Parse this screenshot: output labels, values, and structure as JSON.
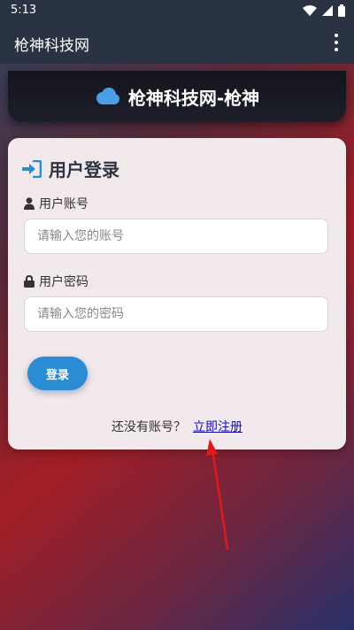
{
  "status_bar": {
    "time": "5:13"
  },
  "app_bar": {
    "title": "枪神科技网"
  },
  "header": {
    "title": "枪神科技网-枪神"
  },
  "login": {
    "title": "用户登录",
    "username_label": "用户账号",
    "username_placeholder": "请输入您的账号",
    "password_label": "用户密码",
    "password_placeholder": "请输入您的密码",
    "login_button": "登录",
    "register_prompt": "还没有账号？",
    "register_link": "立即注册"
  },
  "icons": {
    "header": "cloud-icon",
    "login": "sign-in-icon",
    "username": "user-icon",
    "password": "lock-icon",
    "menu": "more-vert-icon"
  },
  "colors": {
    "accent": "#2b8bd3",
    "link": "#1a0dab",
    "annotation": "#e0191f",
    "appbar": "#2a3344"
  }
}
